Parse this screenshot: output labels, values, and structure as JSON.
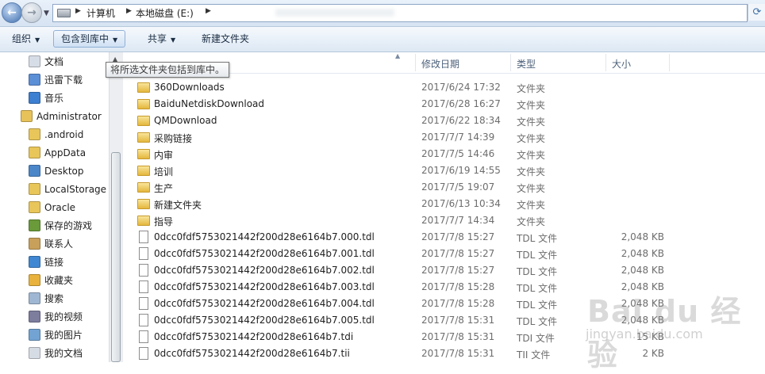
{
  "address": {
    "crumbs": [
      "计算机",
      "本地磁盘 (E:)"
    ],
    "separator": "▶"
  },
  "toolbar": {
    "organize": "组织",
    "include_library": "包含到库中",
    "share": "共享",
    "new_folder": "新建文件夹"
  },
  "tooltip": "将所选文件夹包括到库中。",
  "nav": {
    "items": [
      {
        "label": "文档",
        "icon": "documents-icon"
      },
      {
        "label": "迅雷下载",
        "icon": "thunder-download-icon"
      },
      {
        "label": "音乐",
        "icon": "music-icon"
      },
      {
        "label": "Administrator",
        "icon": "user-folder-icon"
      },
      {
        "label": ".android",
        "icon": "folder-icon"
      },
      {
        "label": "AppData",
        "icon": "folder-icon"
      },
      {
        "label": "Desktop",
        "icon": "desktop-folder-icon"
      },
      {
        "label": "LocalStorage",
        "icon": "folder-icon"
      },
      {
        "label": "Oracle",
        "icon": "folder-icon"
      },
      {
        "label": "保存的游戏",
        "icon": "saved-games-icon"
      },
      {
        "label": "联系人",
        "icon": "contacts-icon"
      },
      {
        "label": "链接",
        "icon": "links-icon"
      },
      {
        "label": "收藏夹",
        "icon": "favorites-icon"
      },
      {
        "label": "搜索",
        "icon": "search-folder-icon"
      },
      {
        "label": "我的视频",
        "icon": "videos-icon"
      },
      {
        "label": "我的图片",
        "icon": "pictures-icon"
      },
      {
        "label": "我的文档",
        "icon": "my-documents-icon"
      }
    ]
  },
  "columns": {
    "date": "修改日期",
    "type": "类型",
    "size": "大小"
  },
  "files": [
    {
      "name": "360Downloads",
      "date": "2017/6/24 17:32",
      "type": "文件夹",
      "size": "",
      "kind": "folder"
    },
    {
      "name": "BaiduNetdiskDownload",
      "date": "2017/6/28 16:27",
      "type": "文件夹",
      "size": "",
      "kind": "folder"
    },
    {
      "name": "QMDownload",
      "date": "2017/6/22 18:34",
      "type": "文件夹",
      "size": "",
      "kind": "folder"
    },
    {
      "name": "采购链接",
      "date": "2017/7/7 14:39",
      "type": "文件夹",
      "size": "",
      "kind": "folder"
    },
    {
      "name": "内审",
      "date": "2017/7/5 14:46",
      "type": "文件夹",
      "size": "",
      "kind": "folder"
    },
    {
      "name": "培训",
      "date": "2017/6/19 14:55",
      "type": "文件夹",
      "size": "",
      "kind": "folder"
    },
    {
      "name": "生产",
      "date": "2017/7/5 19:07",
      "type": "文件夹",
      "size": "",
      "kind": "folder"
    },
    {
      "name": "新建文件夹",
      "date": "2017/6/13 10:34",
      "type": "文件夹",
      "size": "",
      "kind": "folder"
    },
    {
      "name": "指导",
      "date": "2017/7/7 14:34",
      "type": "文件夹",
      "size": "",
      "kind": "folder"
    },
    {
      "name": "0dcc0fdf5753021442f200d28e6164b7.000.tdl",
      "date": "2017/7/8 15:27",
      "type": "TDL 文件",
      "size": "2,048 KB",
      "kind": "file"
    },
    {
      "name": "0dcc0fdf5753021442f200d28e6164b7.001.tdl",
      "date": "2017/7/8 15:27",
      "type": "TDL 文件",
      "size": "2,048 KB",
      "kind": "file"
    },
    {
      "name": "0dcc0fdf5753021442f200d28e6164b7.002.tdl",
      "date": "2017/7/8 15:27",
      "type": "TDL 文件",
      "size": "2,048 KB",
      "kind": "file"
    },
    {
      "name": "0dcc0fdf5753021442f200d28e6164b7.003.tdl",
      "date": "2017/7/8 15:28",
      "type": "TDL 文件",
      "size": "2,048 KB",
      "kind": "file"
    },
    {
      "name": "0dcc0fdf5753021442f200d28e6164b7.004.tdl",
      "date": "2017/7/8 15:28",
      "type": "TDL 文件",
      "size": "2,048 KB",
      "kind": "file"
    },
    {
      "name": "0dcc0fdf5753021442f200d28e6164b7.005.tdl",
      "date": "2017/7/8 15:31",
      "type": "TDL 文件",
      "size": "2,048 KB",
      "kind": "file"
    },
    {
      "name": "0dcc0fdf5753021442f200d28e6164b7.tdi",
      "date": "2017/7/8 15:31",
      "type": "TDI 文件",
      "size": "15 KB",
      "kind": "file"
    },
    {
      "name": "0dcc0fdf5753021442f200d28e6164b7.tii",
      "date": "2017/7/8 15:31",
      "type": "TII 文件",
      "size": "2 KB",
      "kind": "file"
    }
  ],
  "watermark": {
    "main": "Bai du 经验",
    "sub": "jingyan.baidu.com"
  }
}
